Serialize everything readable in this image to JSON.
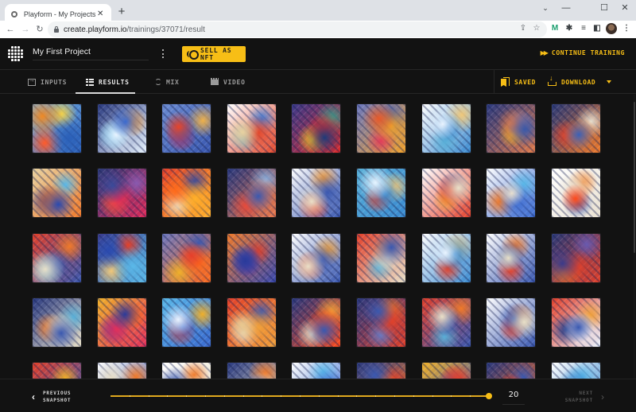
{
  "browser": {
    "tab_title": "Playform - My Projects",
    "url_host": "create.playform.io",
    "url_path": "/trainings/37071/result",
    "icons": [
      "back-arrow-icon",
      "forward-arrow-icon",
      "reload-icon",
      "lock-icon",
      "share-icon",
      "star-icon",
      "extension-m-icon",
      "puzzle-icon",
      "media-queue-icon",
      "sidepanel-icon",
      "profile-avatar",
      "more-vert-icon"
    ],
    "window_controls": [
      "tab-search",
      "minimize",
      "maximize",
      "close"
    ]
  },
  "header": {
    "project_name": "My First Project",
    "sell_nft_label": "SELL AS NFT",
    "continue_training_label": "CONTINUE TRAINING"
  },
  "tabs": [
    {
      "label": "INPUTS",
      "icon": "input-icon",
      "active": false
    },
    {
      "label": "RESULTS",
      "icon": "grid-icon",
      "active": true
    },
    {
      "label": "MIX",
      "icon": "mix-icon",
      "active": false
    },
    {
      "label": "VIDEO",
      "icon": "video-icon",
      "active": false
    }
  ],
  "actions": {
    "saved_label": "SAVED",
    "download_label": "DOWNLOAD"
  },
  "colors": {
    "accent": "#f7be16",
    "background": "#121212"
  },
  "grid": {
    "columns": 9,
    "visible_rows": 5,
    "thumbnail_palettes": [
      [
        "#f08a24",
        "#2a5fb8",
        "#f3d24a",
        "#ff5a2a",
        "#7ab7e8"
      ],
      [
        "#3a6ad0",
        "#e8f4ff",
        "#f09a3a",
        "#5ab8e8",
        "#2a3a80"
      ],
      [
        "#e6452a",
        "#3a58b0",
        "#f0b24a",
        "#d82a4a",
        "#6a8ad0"
      ],
      [
        "#e8d2a0",
        "#e2462a",
        "#3a7ad8",
        "#7ab0c0",
        "#ffffff"
      ],
      [
        "#1f3a7a",
        "#e02a2a",
        "#3a9a8a",
        "#f0c02a",
        "#3a3a8a"
      ],
      [
        "#e85a2a",
        "#f0a02a",
        "#3a58b0",
        "#e23a5a",
        "#6a78c0"
      ],
      [
        "#eaf4ff",
        "#3a8ad0",
        "#f0c87a",
        "#5ab0d8",
        "#ffffff"
      ],
      [
        "#3a58a8",
        "#e07a4a",
        "#6a7ac8",
        "#f0b02a",
        "#2a3a80"
      ],
      [
        "#3a60b8",
        "#f07a2a",
        "#e8e0d0",
        "#e2402a",
        "#2a3a78"
      ],
      [
        "#2a4ab0",
        "#f07a2a",
        "#5ab8e8",
        "#3a3a8a",
        "#e8d2a0"
      ],
      [
        "#3a4a9a",
        "#e02a5a",
        "#8a5ab0",
        "#f05a3a",
        "#2a3a7a"
      ],
      [
        "#ff6a1a",
        "#ffb02a",
        "#3a4a9a",
        "#f0e0c0",
        "#e2402a"
      ],
      [
        "#3a58b0",
        "#f07a4a",
        "#8ab0e0",
        "#e84a3a",
        "#2a3a80"
      ],
      [
        "#eae0c8",
        "#3a58b0",
        "#f09a3a",
        "#e2402a",
        "#ffffff"
      ],
      [
        "#e8f4ff",
        "#3a8ad0",
        "#f0c87a",
        "#e2402a",
        "#5ab0d8"
      ],
      [
        "#eae0c8",
        "#e2402a",
        "#3a58b0",
        "#f0a03a",
        "#ffffff"
      ],
      [
        "#e8e0d0",
        "#3a6ad0",
        "#5ab8e8",
        "#f07a2a",
        "#ffffff"
      ],
      [
        "#ff4a1a",
        "#e8e0d0",
        "#f08a3a",
        "#3a58b0",
        "#ffffff"
      ],
      [
        "#e8e0c8",
        "#3a58b0",
        "#f07a2a",
        "#5ab0d8",
        "#e2402a"
      ],
      [
        "#2a4ab0",
        "#5ab8e8",
        "#e2402a",
        "#f0c87a",
        "#3a3a8a"
      ],
      [
        "#e8402a",
        "#ff6a1a",
        "#3a58b0",
        "#f0b02a",
        "#6a78c0"
      ],
      [
        "#2a3a9a",
        "#3a4ab0",
        "#e2402a",
        "#6a3a9a",
        "#f07a2a"
      ],
      [
        "#eae0c8",
        "#3a58b0",
        "#f0a03a",
        "#e2402a",
        "#ffffff"
      ],
      [
        "#3a58b0",
        "#e8e0c8",
        "#f07a2a",
        "#5ab0d8",
        "#e2402a"
      ],
      [
        "#eaf4ff",
        "#3a8ad0",
        "#f0c87a",
        "#e2402a",
        "#ffffff"
      ],
      [
        "#e8e0c8",
        "#3a58b0",
        "#f07a2a",
        "#e2402a",
        "#ffffff"
      ],
      [
        "#3a3a8a",
        "#e2402a",
        "#6a5ab0",
        "#f07a2a",
        "#2a3a78"
      ],
      [
        "#3a58b0",
        "#e8e0c8",
        "#5ab0d8",
        "#f07a2a",
        "#2a3a80"
      ],
      [
        "#2a3a9a",
        "#e2305a",
        "#ff6a1a",
        "#6a3a9a",
        "#f0b02a"
      ],
      [
        "#eaf4ff",
        "#3a6ad0",
        "#f0b02a",
        "#e2402a",
        "#5ab8e8"
      ],
      [
        "#e8c890",
        "#f0a03a",
        "#3a58b0",
        "#e8e0c8",
        "#e2402a"
      ],
      [
        "#3a58b0",
        "#ff4a1a",
        "#f0a03a",
        "#e8e0c8",
        "#2a3a80"
      ],
      [
        "#3a58b0",
        "#e2402a",
        "#f07a2a",
        "#6a78c0",
        "#2a3a80"
      ],
      [
        "#eae0c8",
        "#3a58b0",
        "#f07a2a",
        "#5ab0d8",
        "#e2402a"
      ],
      [
        "#e8e0c8",
        "#3a58b0",
        "#f07a2a",
        "#e2402a",
        "#ffffff"
      ],
      [
        "#3a58b0",
        "#eaf4ff",
        "#f0a03a",
        "#1f3a8a",
        "#e2402a"
      ],
      [
        "#e8402a",
        "#3a58b0",
        "#f0b02a",
        "#5ab0d8",
        "#e2402a"
      ],
      [
        "#eae0c8",
        "#3a58b0",
        "#f07a2a",
        "#5ab0d8",
        "#ffffff"
      ],
      [
        "#3a58b0",
        "#eae0c8",
        "#f07a2a",
        "#e2402a",
        "#ffffff"
      ],
      [
        "#3a58b0",
        "#e8e0c8",
        "#f07a2a",
        "#e2402a",
        "#2a3a80"
      ],
      [
        "#eae0c8",
        "#3a6ad0",
        "#5ab8e8",
        "#f07a2a",
        "#ffffff"
      ],
      [
        "#3a58b0",
        "#f07a2a",
        "#e2402a",
        "#eae0c8",
        "#2a3a80"
      ],
      [
        "#e8402a",
        "#3a58b0",
        "#ff4a1a",
        "#6a3a9a",
        "#f0b02a"
      ],
      [
        "#e8402a",
        "#ff6a1a",
        "#3a58b0",
        "#f0b02a",
        "#2a3a80"
      ],
      [
        "#eaf4ff",
        "#3a8ad0",
        "#5ab8e8",
        "#f07a2a",
        "#ffffff"
      ]
    ]
  },
  "footer": {
    "prev_line1": "PREVIOUS",
    "prev_line2": "SNAPSHOT",
    "next_line1": "NEXT",
    "next_line2": "SNAPSHOT",
    "snapshot_value": "20",
    "slider_ticks": 20,
    "slider_position_fraction": 1.0
  }
}
